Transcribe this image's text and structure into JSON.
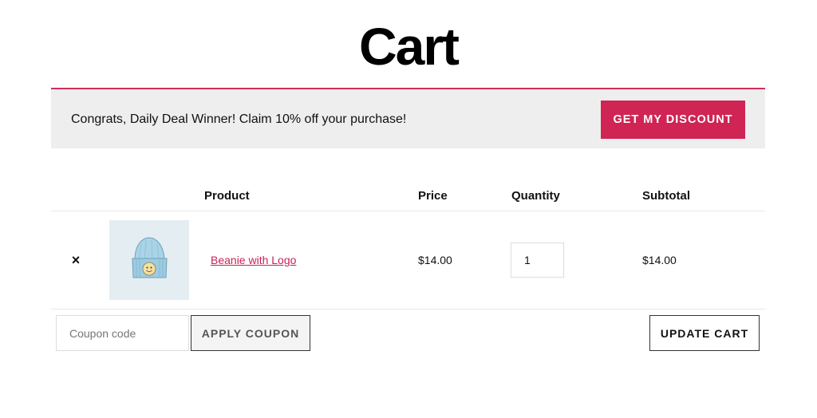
{
  "page": {
    "title": "Cart"
  },
  "notice": {
    "message": "Congrats, Daily Deal Winner! Claim 10% off your purchase!",
    "button_label": "GET MY DISCOUNT",
    "accent_color": "#cf2454"
  },
  "table": {
    "headers": [
      "Product",
      "Price",
      "Quantity",
      "Subtotal"
    ]
  },
  "items": [
    {
      "remove_label": "×",
      "thumbnail_icon": "beanie-icon",
      "name": "Beanie with Logo",
      "price": "$14.00",
      "quantity": "1",
      "subtotal": "$14.00"
    }
  ],
  "actions": {
    "coupon_placeholder": "Coupon code",
    "apply_label": "APPLY COUPON",
    "update_label": "UPDATE CART"
  }
}
